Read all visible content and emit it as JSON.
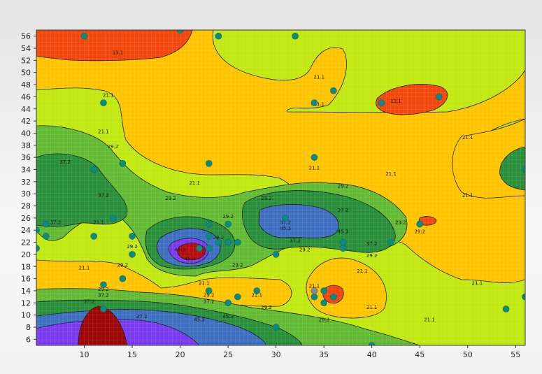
{
  "chart_data": {
    "type": "contour",
    "title": "",
    "xlabel": "",
    "ylabel": "",
    "xlim": [
      5,
      56
    ],
    "ylim": [
      5,
      57
    ],
    "x_ticks": [
      10,
      15,
      20,
      25,
      30,
      35,
      40,
      45,
      50,
      55
    ],
    "y_ticks": [
      6,
      8,
      10,
      12,
      14,
      16,
      18,
      20,
      22,
      24,
      26,
      28,
      30,
      32,
      34,
      36,
      38,
      40,
      42,
      44,
      46,
      48,
      50,
      52,
      54,
      56
    ],
    "grid": true,
    "contour_levels": [
      13.1,
      21.1,
      29.2,
      37.2,
      45.3
    ],
    "band_colors": [
      "#f2470c",
      "#ffc400",
      "#c2e812",
      "#62bb33",
      "#2a8f3a",
      "#3e6fc0",
      "#7a3bf0",
      "#b80c0c"
    ],
    "line_color": "#1a1a1a",
    "point_color": "#0e8a82",
    "points": [
      [
        10,
        56
      ],
      [
        20,
        57
      ],
      [
        24,
        56
      ],
      [
        32,
        56
      ],
      [
        36,
        47
      ],
      [
        34,
        45
      ],
      [
        41,
        45
      ],
      [
        47,
        46
      ],
      [
        12,
        45
      ],
      [
        14,
        35
      ],
      [
        23,
        35
      ],
      [
        34,
        36
      ],
      [
        56,
        34
      ],
      [
        11,
        34
      ],
      [
        13,
        26
      ],
      [
        5,
        24
      ],
      [
        6,
        25
      ],
      [
        6,
        23
      ],
      [
        11,
        23
      ],
      [
        5,
        21
      ],
      [
        15,
        23
      ],
      [
        15,
        20
      ],
      [
        14,
        16
      ],
      [
        12,
        15
      ],
      [
        12,
        11
      ],
      [
        22,
        21
      ],
      [
        23,
        25
      ],
      [
        25,
        25
      ],
      [
        23,
        23
      ],
      [
        24,
        22
      ],
      [
        25,
        22
      ],
      [
        26,
        22
      ],
      [
        23,
        21
      ],
      [
        30,
        20
      ],
      [
        31,
        26
      ],
      [
        37,
        22
      ],
      [
        37,
        21
      ],
      [
        42,
        22
      ],
      [
        45,
        25
      ],
      [
        23,
        14
      ],
      [
        28,
        14
      ],
      [
        26,
        13
      ],
      [
        25,
        12
      ],
      [
        34,
        14
      ],
      [
        35,
        14
      ],
      [
        34,
        13
      ],
      [
        35,
        12
      ],
      [
        36,
        13
      ],
      [
        30,
        8
      ],
      [
        40,
        5
      ],
      [
        54,
        11
      ],
      [
        56,
        13
      ]
    ],
    "highlight_point": [
      34,
      14
    ],
    "highlight_color": "#888888"
  }
}
